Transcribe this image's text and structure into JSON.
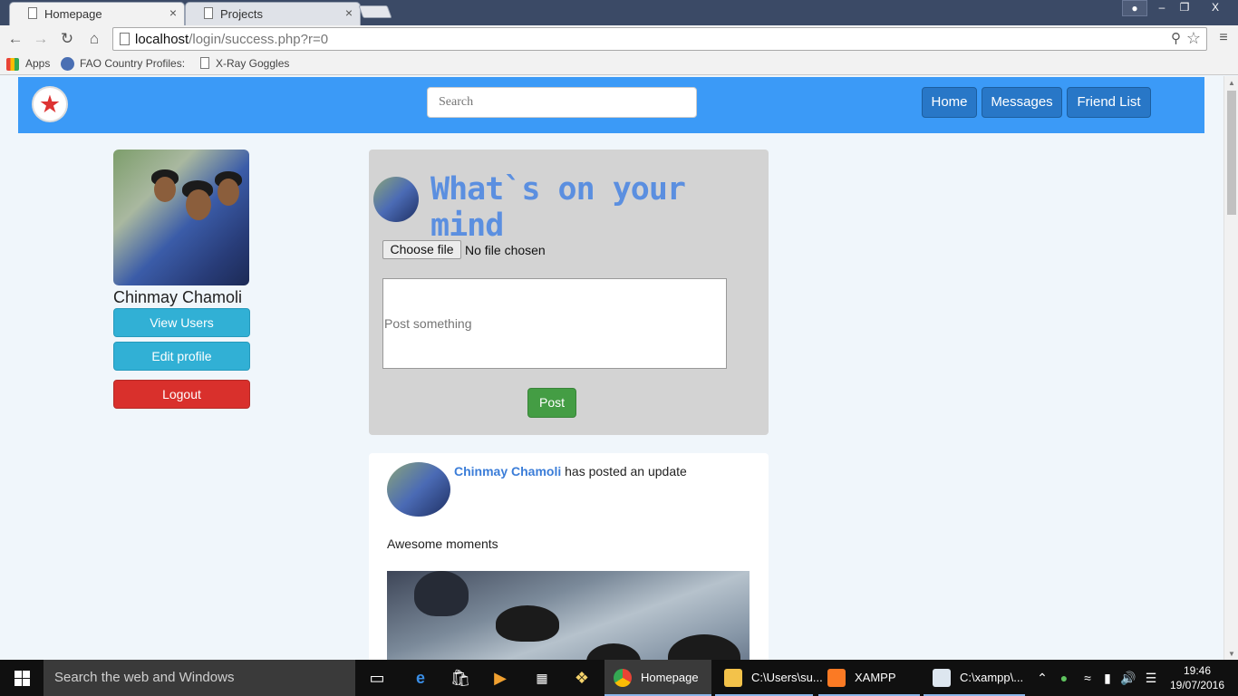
{
  "browser": {
    "tabs": [
      {
        "label": "Homepage",
        "close": "×"
      },
      {
        "label": "Projects",
        "close": "×"
      }
    ],
    "window_controls": {
      "minimize": "–",
      "maximize": "❐",
      "close": "X"
    },
    "url": {
      "host": "localhost",
      "path": "/login/success.php?r=0"
    },
    "bookmarks": [
      {
        "label": "Apps"
      },
      {
        "label": "FAO Country Profiles:"
      },
      {
        "label": "X-Ray Goggles"
      }
    ]
  },
  "nav": {
    "search_placeholder": "Search",
    "links": [
      "Home",
      "Messages",
      "Friend List"
    ],
    "color": "#3b9af7"
  },
  "profile": {
    "name": "Chinmay Chamoli",
    "buttons": {
      "view_users": "View Users",
      "edit_profile": "Edit profile",
      "logout": "Logout"
    }
  },
  "composer": {
    "heading": "What`s on your mind",
    "choose_file": "Choose file",
    "file_status": "No file chosen",
    "post_placeholder": "Post something",
    "post_button": "Post"
  },
  "feed": {
    "author": "Chinmay Chamoli",
    "action": " has posted an update",
    "text": "Awesome moments"
  },
  "taskbar": {
    "search_placeholder": "Search the web and Windows",
    "apps": [
      {
        "label": "Homepage ..."
      },
      {
        "label": "C:\\Users\\su..."
      },
      {
        "label": "XAMPP Co..."
      },
      {
        "label": "C:\\xampp\\..."
      }
    ],
    "time": "19:46",
    "date": "19/07/2016"
  }
}
